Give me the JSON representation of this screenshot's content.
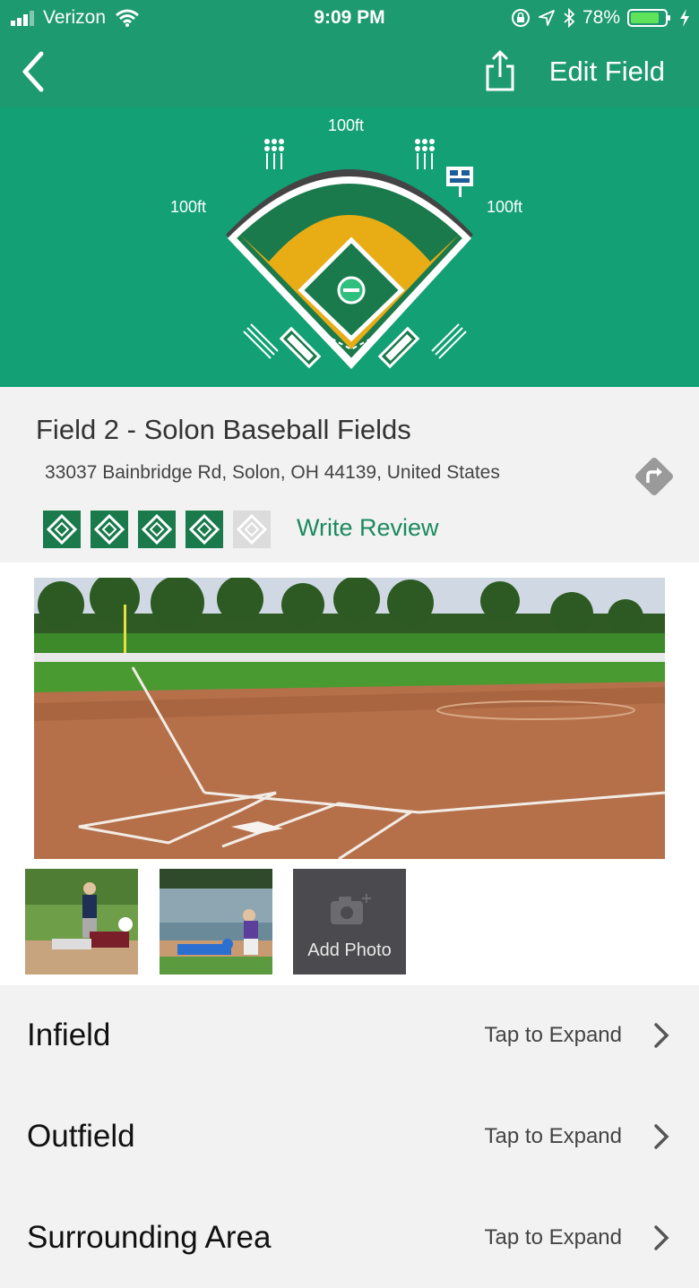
{
  "status_bar": {
    "carrier": "Verizon",
    "time": "9:09 PM",
    "battery": "78%"
  },
  "nav": {
    "edit_label": "Edit Field"
  },
  "diagram": {
    "center_distance": "100ft",
    "left_distance": "100ft",
    "right_distance": "100ft"
  },
  "field": {
    "title": "Field 2 - Solon Baseball Fields",
    "address": "33037 Bainbridge Rd, Solon, OH 44139, United States",
    "rating": 4,
    "rating_max": 5,
    "write_review_label": "Write Review"
  },
  "photos": {
    "add_photo_label": "Add Photo"
  },
  "sections": [
    {
      "name": "Infield",
      "action": "Tap to Expand"
    },
    {
      "name": "Outfield",
      "action": "Tap to Expand"
    },
    {
      "name": "Surrounding Area",
      "action": "Tap to Expand"
    }
  ],
  "colors": {
    "brand_green": "#1e9a70",
    "hero_green": "#13a075",
    "dark_green": "#1a7a4c",
    "infield_gold": "#e8ac14"
  },
  "icons": [
    "back-chevron-icon",
    "share-icon",
    "directions-icon",
    "camera-icon",
    "chevron-right-icon"
  ]
}
